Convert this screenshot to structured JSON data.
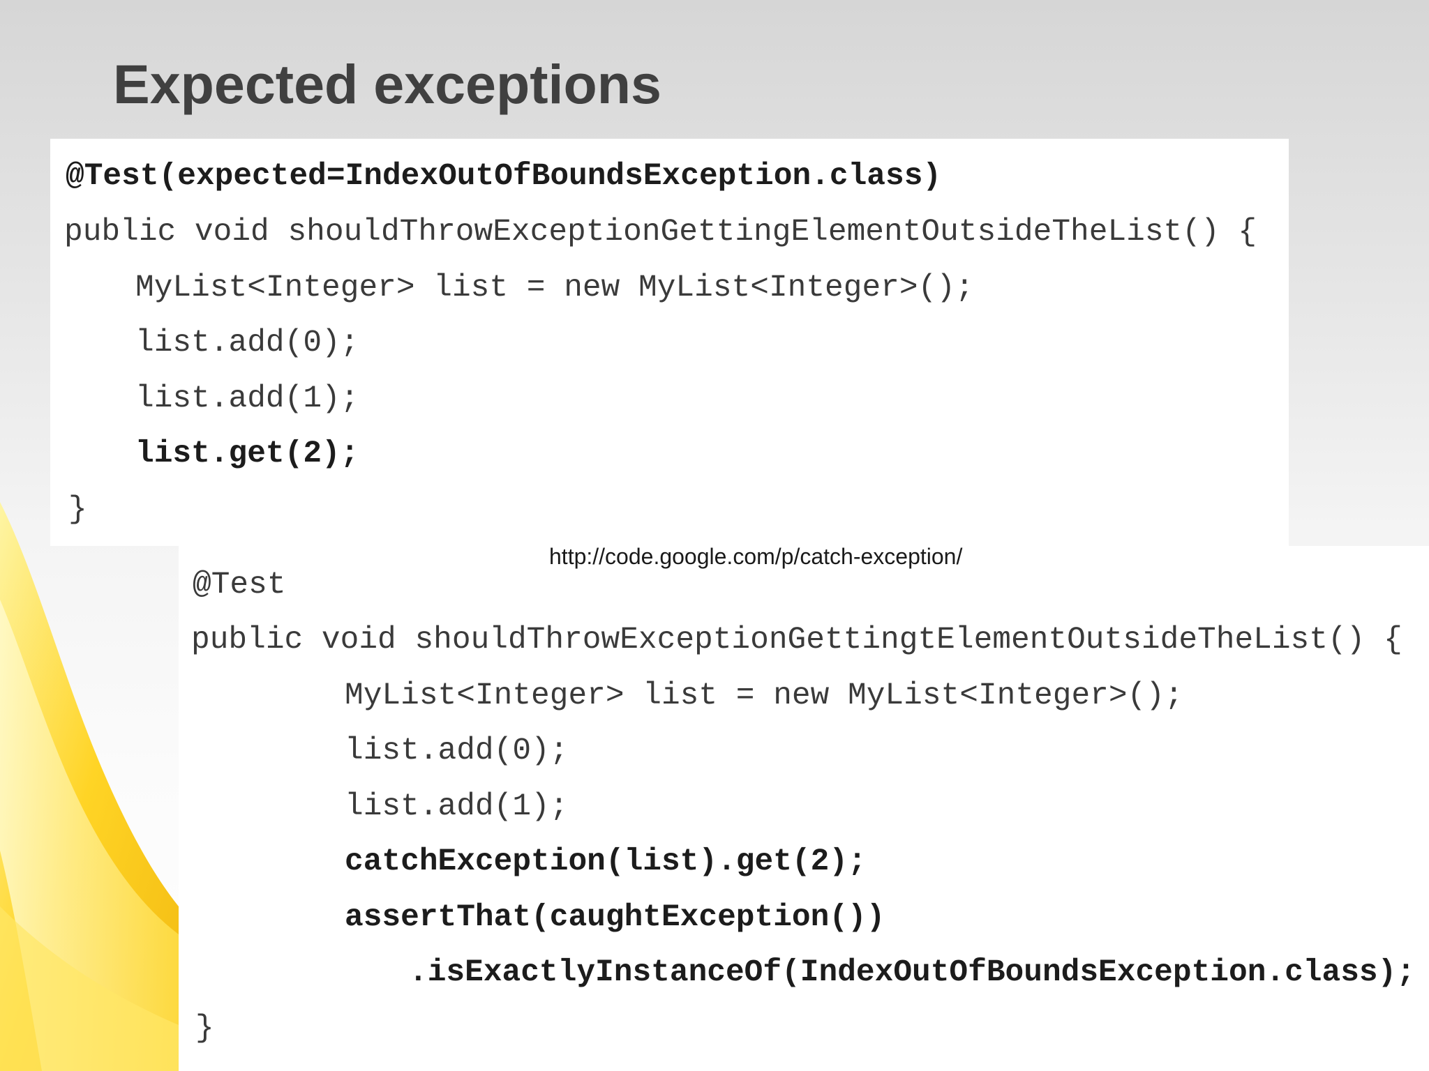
{
  "slide": {
    "title": "Expected exceptions"
  },
  "code_block_one": {
    "lines": [
      "@Test(expected=IndexOutOfBoundsException.class)",
      "public void shouldThrowExceptionGettingElementOutsideTheList() {",
      "MyList<Integer> list = new MyList<Integer>();",
      "list.add(0);",
      "list.add(1);",
      "list.get(2);",
      "}"
    ]
  },
  "source_link": "http://code.google.com/p/catch-exception/",
  "code_block_two": {
    "lines": [
      "@Test",
      "public void shouldThrowExceptionGettingtElementOutsideTheList() {",
      "MyList<Integer> list = new MyList<Integer>();",
      "list.add(0);",
      "list.add(1);",
      "catchException(list).get(2);",
      "assertThat(caughtException())",
      ".isExactlyInstanceOf(IndexOutOfBoundsException.class);",
      "}"
    ]
  },
  "colors": {
    "title": "#404040",
    "code": "#3a3a3a",
    "code_emphasis": "#1c1c1c",
    "swoosh_light": "#fff27a",
    "swoosh_mid": "#ffd21a",
    "swoosh_dark": "#f2b705"
  }
}
